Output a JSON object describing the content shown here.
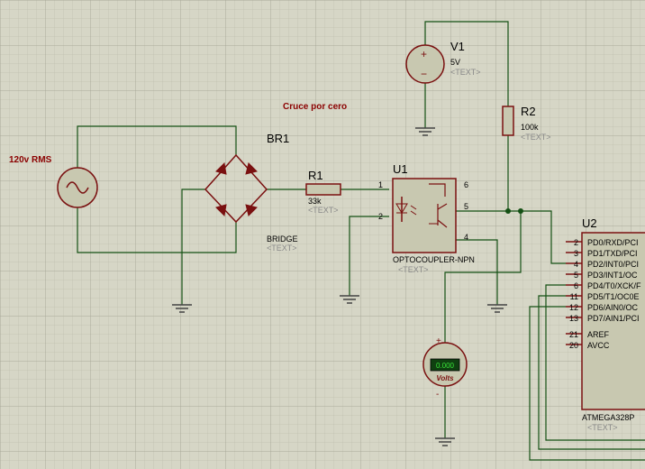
{
  "annotations": {
    "zero_cross": "Cruce por cero",
    "source_label": "120v RMS"
  },
  "placeholder": "<TEXT>",
  "bridge": {
    "ref": "BR1",
    "value": "BRIDGE"
  },
  "resistor1": {
    "ref": "R1",
    "value": "33k"
  },
  "resistor2": {
    "ref": "R2",
    "value": "100k"
  },
  "v1": {
    "ref": "V1",
    "value": "5V"
  },
  "optocoupler": {
    "ref": "U1",
    "value": "OPTOCOUPLER-NPN",
    "pins": {
      "p1": "1",
      "p2": "2",
      "p4": "4",
      "p5": "5",
      "p6": "6"
    }
  },
  "mcu": {
    "ref": "U2",
    "value": "ATMEGA328P",
    "pins": [
      {
        "num": "2",
        "name": "PD0/RXD/PCI"
      },
      {
        "num": "3",
        "name": "PD1/TXD/PCI"
      },
      {
        "num": "4",
        "name": "PD2/INT0/PCI"
      },
      {
        "num": "5",
        "name": "PD3/INT1/OC"
      },
      {
        "num": "6",
        "name": "PD4/T0/XCK/F"
      },
      {
        "num": "11",
        "name": "PD5/T1/OC0E"
      },
      {
        "num": "12",
        "name": "PD6/AIN0/OC"
      },
      {
        "num": "13",
        "name": "PD7/AIN1/PCI"
      },
      {
        "num": "21",
        "name": "AREF"
      },
      {
        "num": "20",
        "name": "AVCC"
      }
    ]
  },
  "voltmeter": {
    "display": "0.000",
    "unit": "Volts",
    "plus": "+",
    "minus": "-"
  },
  "v1_signs": {
    "plus": "+",
    "minus": "−"
  }
}
